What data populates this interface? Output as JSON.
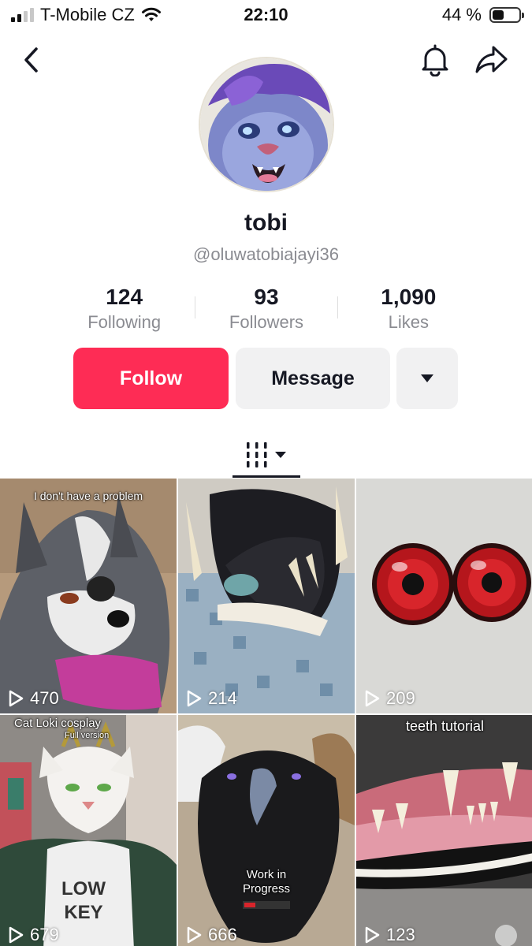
{
  "status_bar": {
    "carrier": "T-Mobile CZ",
    "time": "22:10",
    "battery": "44 %",
    "battery_level": 0.44
  },
  "profile": {
    "display_name": "tobi",
    "handle": "@oluwatobiajayi36"
  },
  "stats": [
    {
      "value": "124",
      "label": "Following"
    },
    {
      "value": "93",
      "label": "Followers"
    },
    {
      "value": "1,090",
      "label": "Likes"
    }
  ],
  "actions": {
    "follow_label": "Follow",
    "message_label": "Message"
  },
  "colors": {
    "accent": "#fe2c55",
    "secondary_button": "#f1f1f2",
    "muted_text": "#8a8b91"
  },
  "videos": [
    {
      "views": "470",
      "caption": "I don't have a problem"
    },
    {
      "views": "214",
      "caption": ""
    },
    {
      "views": "209",
      "caption": ""
    },
    {
      "views": "679",
      "caption": "Cat Loki cosplay",
      "caption_secondary": "Full version",
      "shirt_text": "LOW KEY"
    },
    {
      "views": "666",
      "caption": "",
      "overlay": "Work in Progress"
    },
    {
      "views": "123",
      "caption": "teeth tutorial"
    }
  ],
  "icons": {
    "back": "chevron-left-icon",
    "notifications": "bell-icon",
    "share": "share-arrow-icon",
    "more": "caret-down-icon",
    "grid_tab": "grid-columns-icon",
    "play": "play-outline-icon"
  }
}
